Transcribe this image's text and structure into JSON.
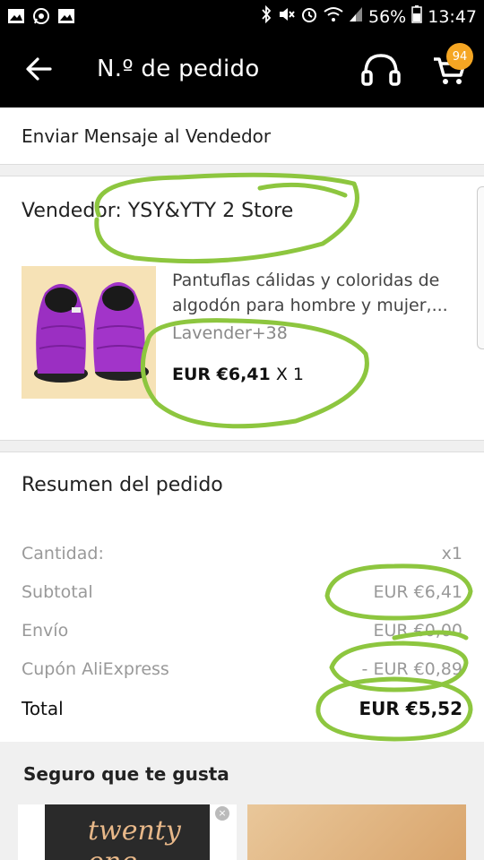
{
  "status_bar": {
    "battery": "56%",
    "time": "13:47"
  },
  "app_bar": {
    "title": "N.º de pedido",
    "cart_count": "94"
  },
  "message_seller": {
    "label": "Enviar Mensaje al Vendedor"
  },
  "order": {
    "seller": "Vendedor: YSY&YTY 2 Store",
    "product": {
      "title": "Pantuflas cálidas y coloridas de algodón para hombre y mujer,...",
      "variant": "Lavender+38",
      "price": "EUR €6,41",
      "quantity": "X 1"
    }
  },
  "summary": {
    "title": "Resumen del pedido",
    "rows": [
      {
        "label": "Cantidad:",
        "value": "x1"
      },
      {
        "label": "Subtotal",
        "value": "EUR €6,41"
      },
      {
        "label": "Envío",
        "value": "EUR €0,00"
      },
      {
        "label": "Cupón AliExpress",
        "value": "- EUR €0,89"
      }
    ],
    "total": {
      "label": "Total",
      "value": "EUR €5,52"
    }
  },
  "recommendations": {
    "title": "Seguro que te gusta",
    "card1_text": "twenty one"
  },
  "colors": {
    "bar_bg": "#000000",
    "badge": "#f5a623",
    "annotation": "#8dc63f"
  }
}
